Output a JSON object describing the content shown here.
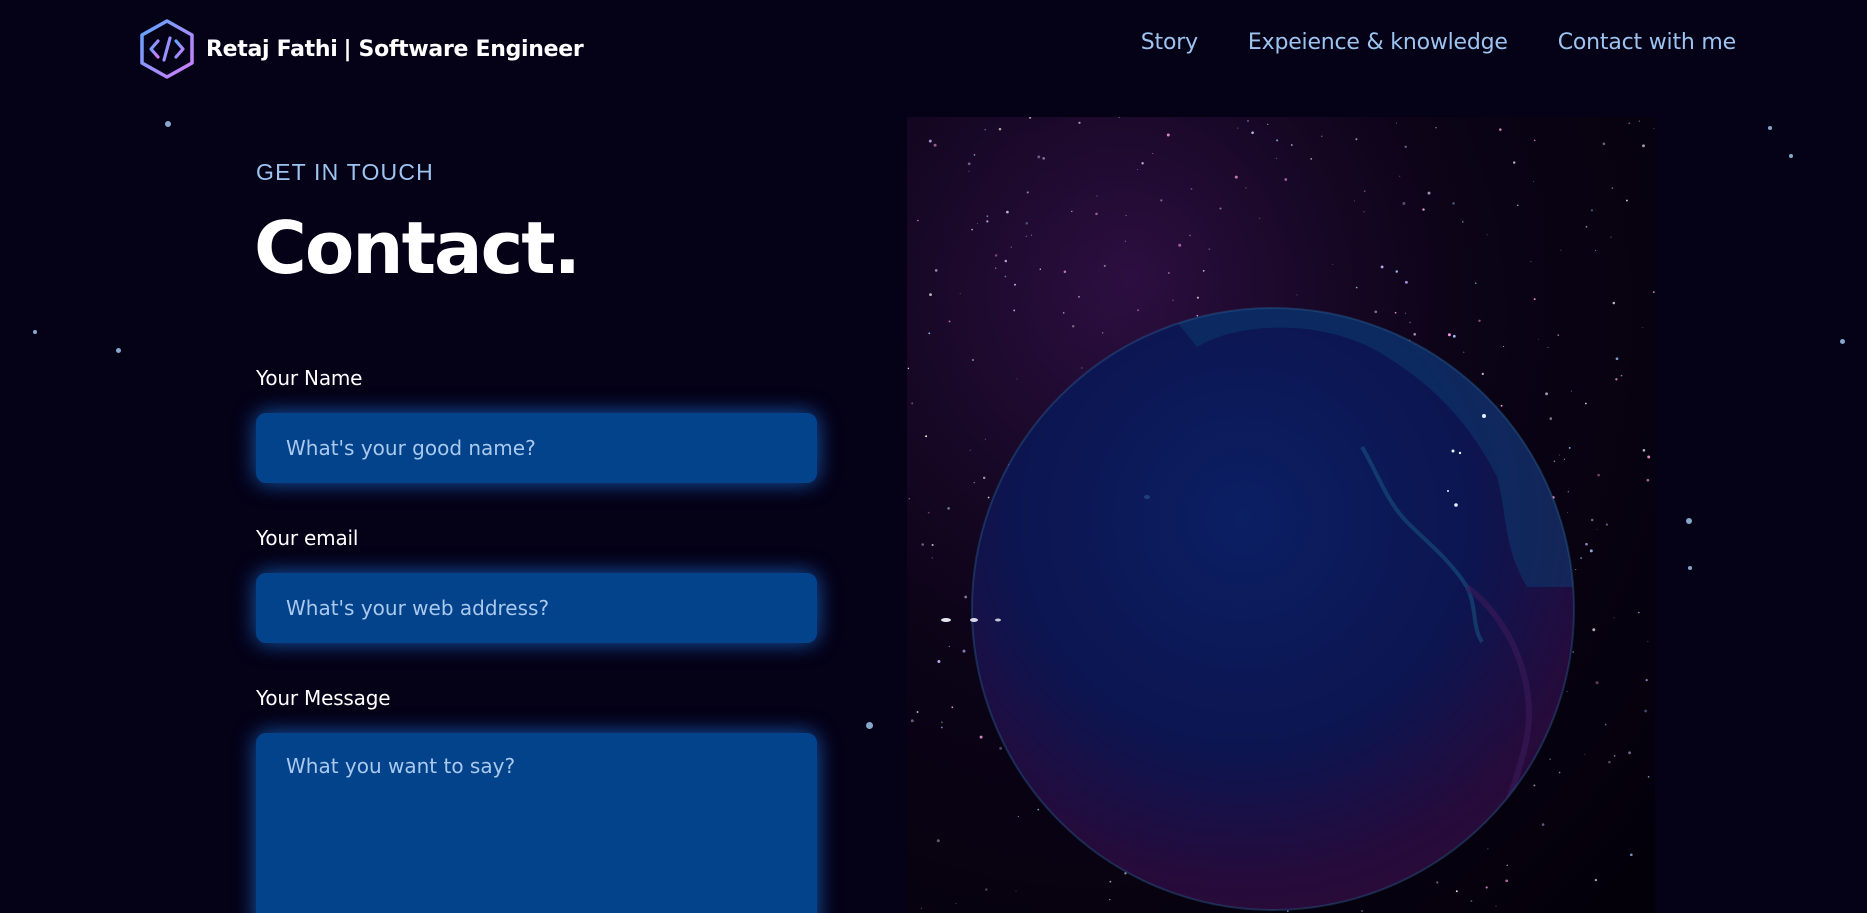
{
  "colors": {
    "background": "#050116",
    "accent": "#9cc4ef",
    "field_background": "#03438b",
    "field_glow": "#1a78e6",
    "text": "#ffffff"
  },
  "navbar": {
    "logo_icon": "code-hexagon-icon",
    "brand_name": "Retaj Fathi",
    "brand_role": "| Software Engineer",
    "links": [
      {
        "label": "Story"
      },
      {
        "label": "Expeience & knowledge"
      },
      {
        "label": "Contact with me"
      }
    ]
  },
  "contact": {
    "eyebrow": "GET IN TOUCH",
    "title": "Contact.",
    "fields": {
      "name": {
        "label": "Your Name",
        "placeholder": "What's your good name?",
        "value": ""
      },
      "email": {
        "label": "Your email",
        "placeholder": "What's your web address?",
        "value": ""
      },
      "message": {
        "label": "Your Message",
        "placeholder": "What you want to say?",
        "value": ""
      }
    }
  },
  "visual": {
    "type": "3d-earth-globe",
    "icon": "earth-globe-icon"
  }
}
